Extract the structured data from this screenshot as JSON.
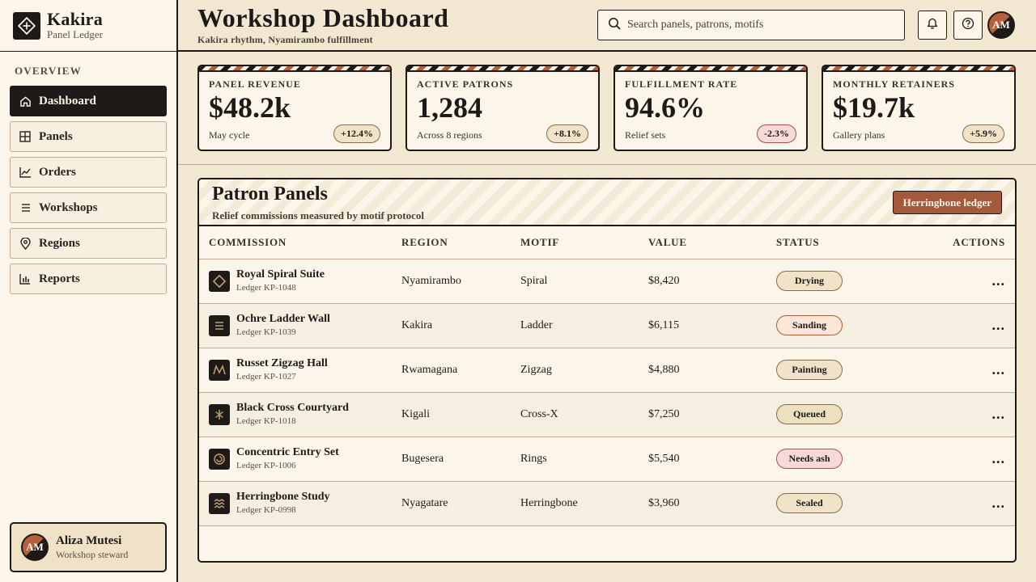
{
  "brand": {
    "name": "Kakira",
    "subtitle": "Panel Ledger"
  },
  "sidebar": {
    "section": "OVERVIEW",
    "items": [
      {
        "label": "Dashboard",
        "icon": "home-icon",
        "active": true
      },
      {
        "label": "Panels",
        "icon": "grid-icon"
      },
      {
        "label": "Orders",
        "icon": "chart-line-icon"
      },
      {
        "label": "Workshops",
        "icon": "list-icon"
      },
      {
        "label": "Regions",
        "icon": "map-pin-icon"
      },
      {
        "label": "Reports",
        "icon": "bar-chart-icon"
      }
    ],
    "user": {
      "initials": "AM",
      "name": "Aliza Mutesi",
      "role": "Workshop steward"
    }
  },
  "header": {
    "title": "Workshop Dashboard",
    "subtitle": "Kakira rhythm, Nyamirambo fulfillment",
    "search_placeholder": "Search panels, patrons, motifs",
    "avatar_initials": "AM"
  },
  "stats": [
    {
      "label": "PANEL REVENUE",
      "value": "$48.2k",
      "note": "May cycle",
      "delta": "+12.4%"
    },
    {
      "label": "ACTIVE PATRONS",
      "value": "1,284",
      "note": "Across 8 regions",
      "delta": "+8.1%"
    },
    {
      "label": "FULFILLMENT RATE",
      "value": "94.6%",
      "note": "Relief sets",
      "delta": "-2.3%"
    },
    {
      "label": "MONTHLY RETAINERS",
      "value": "$19.7k",
      "note": "Gallery plans",
      "delta": "+5.9%"
    }
  ],
  "panel": {
    "title": "Patron Panels",
    "subtitle": "Relief commissions measured by motif protocol",
    "button": "Herringbone ledger",
    "columns": [
      "COMMISSION",
      "REGION",
      "MOTIF",
      "VALUE",
      "STATUS",
      "ACTIONS"
    ],
    "rows": [
      {
        "name": "Royal Spiral Suite",
        "ledger": "Ledger KP-1048",
        "region": "Nyamirambo",
        "motif": "Spiral",
        "value": "$8,420",
        "status": "Drying",
        "motif_icon": "diamond-motif-icon"
      },
      {
        "name": "Ochre Ladder Wall",
        "ledger": "Ledger KP-1039",
        "region": "Kakira",
        "motif": "Ladder",
        "value": "$6,115",
        "status": "Sanding",
        "motif_icon": "ladder-motif-icon"
      },
      {
        "name": "Russet Zigzag Hall",
        "ledger": "Ledger KP-1027",
        "region": "Rwamagana",
        "motif": "Zigzag",
        "value": "$4,880",
        "status": "Painting",
        "motif_icon": "zigzag-motif-icon"
      },
      {
        "name": "Black Cross Courtyard",
        "ledger": "Ledger KP-1018",
        "region": "Kigali",
        "motif": "Cross-X",
        "value": "$7,250",
        "status": "Queued",
        "motif_icon": "cross-motif-icon"
      },
      {
        "name": "Concentric Entry Set",
        "ledger": "Ledger KP-1006",
        "region": "Bugesera",
        "motif": "Rings",
        "value": "$5,540",
        "status": "Needs ash",
        "motif_icon": "rings-motif-icon"
      },
      {
        "name": "Herringbone Study",
        "ledger": "Ledger KP-0998",
        "region": "Nyagatare",
        "motif": "Herringbone",
        "value": "$3,960",
        "status": "Sealed",
        "motif_icon": "herringbone-motif-icon"
      }
    ],
    "more_glyph": "..."
  }
}
